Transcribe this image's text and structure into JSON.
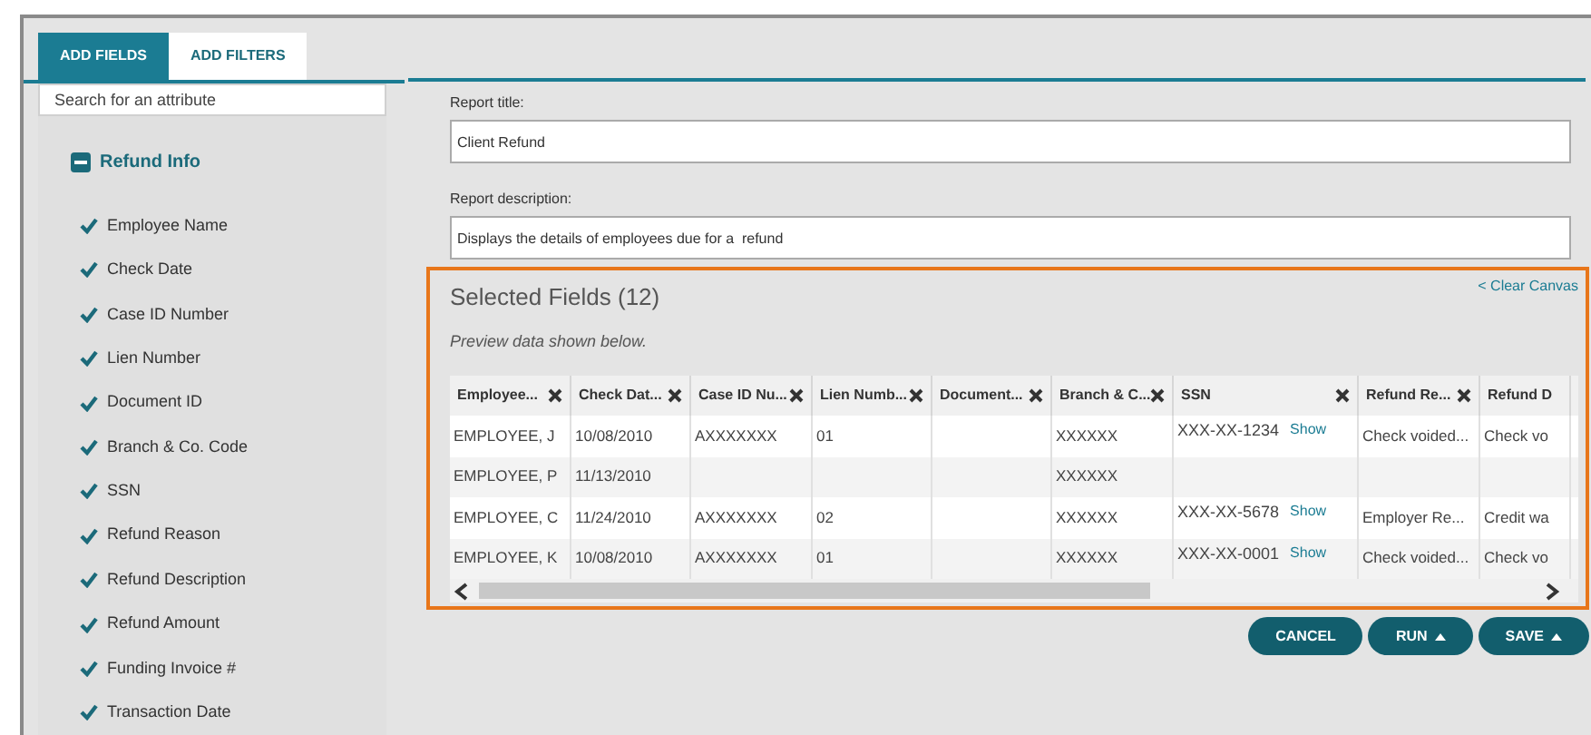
{
  "tabs": [
    {
      "label": "ADD FIELDS",
      "selected": true
    },
    {
      "label": "ADD FILTERS",
      "selected": false
    }
  ],
  "sidebar": {
    "search": {
      "placeholder": "Search for an attribute"
    },
    "group": {
      "label": "Refund Info",
      "expanded": true,
      "items": [
        {
          "label": "Employee Name",
          "checked": true
        },
        {
          "label": "Check Date",
          "checked": true
        },
        {
          "label": "Case ID Number",
          "checked": true
        },
        {
          "label": "Lien Number",
          "checked": true
        },
        {
          "label": "Document ID",
          "checked": true
        },
        {
          "label": "Branch & Co. Code",
          "checked": true
        },
        {
          "label": "SSN",
          "checked": true
        },
        {
          "label": "Refund Reason",
          "checked": true
        },
        {
          "label": "Refund Description",
          "checked": true
        },
        {
          "label": "Refund Amount",
          "checked": true
        },
        {
          "label": "Funding Invoice #",
          "checked": true
        },
        {
          "label": "Transaction Date",
          "checked": true
        }
      ]
    }
  },
  "report_title": {
    "label": "Report title:",
    "value": "Client Refund"
  },
  "report_description": {
    "label": "Report description:",
    "value": "Displays the details of employees due for a  refund"
  },
  "selected_fields": {
    "title": "Selected Fields (12)",
    "clear_link": "< Clear Canvas",
    "note": "Preview data shown below.",
    "table": {
      "columns": [
        {
          "label": "Employee...",
          "removable": true
        },
        {
          "label": "Check Dat...",
          "removable": true
        },
        {
          "label": "Case ID Nu...",
          "removable": true
        },
        {
          "label": "Lien Numb...",
          "removable": true
        },
        {
          "label": "Document...",
          "removable": true
        },
        {
          "label": "Branch & C...",
          "removable": true
        },
        {
          "label": "SSN",
          "removable": true
        },
        {
          "label": "Refund Re...",
          "removable": true
        },
        {
          "label": "Refund D",
          "removable": false
        }
      ],
      "rows": [
        {
          "cells": [
            "EMPLOYEE, J",
            "10/08/2010",
            "AXXXXXXX",
            "01",
            null,
            "XXXXXX",
            {
              "text": "XXX-XX-1234",
              "link": "Show"
            },
            "Check voided...",
            "Check vo"
          ]
        },
        {
          "cells": [
            "EMPLOYEE, P",
            "11/13/2010",
            null,
            null,
            null,
            "XXXXXX",
            null,
            null,
            null
          ]
        },
        {
          "cells": [
            "EMPLOYEE, C",
            "11/24/2010",
            "AXXXXXXX",
            "02",
            null,
            "XXXXXX",
            {
              "text": "XXX-XX-5678",
              "link": "Show"
            },
            "Employer Re...",
            "Credit wa"
          ]
        },
        {
          "cells": [
            "EMPLOYEE, K",
            "10/08/2010",
            "AXXXXXXX",
            "01",
            null,
            "XXXXXX",
            {
              "text": "XXX-XX-0001",
              "link": "Show"
            },
            "Check voided...",
            "Check vo"
          ]
        }
      ]
    }
  },
  "buttons": [
    {
      "label": "CANCEL",
      "menu": false
    },
    {
      "label": "RUN",
      "menu": true
    },
    {
      "label": "SAVE",
      "menu": true
    }
  ]
}
